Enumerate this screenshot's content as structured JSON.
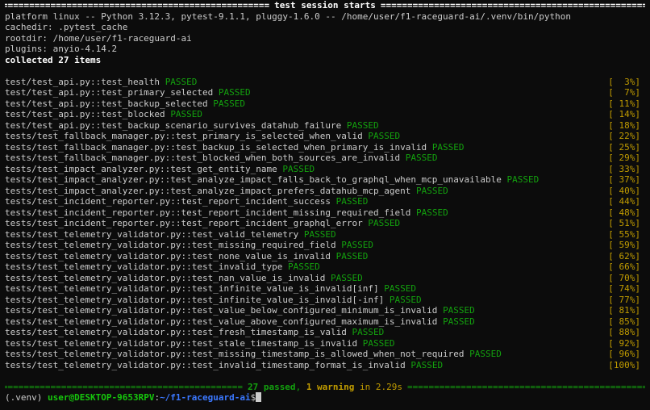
{
  "session": {
    "header_title": "test session starts",
    "platform_line": "platform linux -- Python 3.12.3, pytest-9.1.1, pluggy-1.6.0 -- /home/user/f1-raceguard-ai/.venv/bin/python",
    "cachedir_line": "cachedir: .pytest_cache",
    "rootdir_line": "rootdir: /home/user/f1-raceguard-ai",
    "plugins_line": "plugins: anyio-4.14.2",
    "collected_line": "collected 27 items"
  },
  "status_label": "PASSED",
  "tests": [
    {
      "name": "test/test_api.py::test_health",
      "pct": "[  3%]"
    },
    {
      "name": "test/test_api.py::test_primary_selected",
      "pct": "[  7%]"
    },
    {
      "name": "test/test_api.py::test_backup_selected",
      "pct": "[ 11%]"
    },
    {
      "name": "test/test_api.py::test_blocked",
      "pct": "[ 14%]"
    },
    {
      "name": "test/test_api.py::test_backup_scenario_survives_datahub_failure",
      "pct": "[ 18%]"
    },
    {
      "name": "tests/test_fallback_manager.py::test_primary_is_selected_when_valid",
      "pct": "[ 22%]"
    },
    {
      "name": "tests/test_fallback_manager.py::test_backup_is_selected_when_primary_is_invalid",
      "pct": "[ 25%]"
    },
    {
      "name": "tests/test_fallback_manager.py::test_blocked_when_both_sources_are_invalid",
      "pct": "[ 29%]"
    },
    {
      "name": "tests/test_impact_analyzer.py::test_get_entity_name",
      "pct": "[ 33%]"
    },
    {
      "name": "tests/test_impact_analyzer.py::test_analyze_impact_falls_back_to_graphql_when_mcp_unavailable",
      "pct": "[ 37%]"
    },
    {
      "name": "tests/test_impact_analyzer.py::test_analyze_impact_prefers_datahub_mcp_agent",
      "pct": "[ 40%]"
    },
    {
      "name": "tests/test_incident_reporter.py::test_report_incident_success",
      "pct": "[ 44%]"
    },
    {
      "name": "tests/test_incident_reporter.py::test_report_incident_missing_required_field",
      "pct": "[ 48%]"
    },
    {
      "name": "tests/test_incident_reporter.py::test_report_incident_graphql_error",
      "pct": "[ 51%]"
    },
    {
      "name": "tests/test_telemetry_validator.py::test_valid_telemetry",
      "pct": "[ 55%]"
    },
    {
      "name": "tests/test_telemetry_validator.py::test_missing_required_field",
      "pct": "[ 59%]"
    },
    {
      "name": "tests/test_telemetry_validator.py::test_none_value_is_invalid",
      "pct": "[ 62%]"
    },
    {
      "name": "tests/test_telemetry_validator.py::test_invalid_type",
      "pct": "[ 66%]"
    },
    {
      "name": "tests/test_telemetry_validator.py::test_nan_value_is_invalid",
      "pct": "[ 70%]"
    },
    {
      "name": "tests/test_telemetry_validator.py::test_infinite_value_is_invalid[inf]",
      "pct": "[ 74%]"
    },
    {
      "name": "tests/test_telemetry_validator.py::test_infinite_value_is_invalid[-inf]",
      "pct": "[ 77%]"
    },
    {
      "name": "tests/test_telemetry_validator.py::test_value_below_configured_minimum_is_invalid",
      "pct": "[ 81%]"
    },
    {
      "name": "tests/test_telemetry_validator.py::test_value_above_configured_maximum_is_invalid",
      "pct": "[ 85%]"
    },
    {
      "name": "tests/test_telemetry_validator.py::test_fresh_timestamp_is_valid",
      "pct": "[ 88%]"
    },
    {
      "name": "tests/test_telemetry_validator.py::test_stale_timestamp_is_invalid",
      "pct": "[ 92%]"
    },
    {
      "name": "tests/test_telemetry_validator.py::test_missing_timestamp_is_allowed_when_not_required",
      "pct": "[ 96%]"
    },
    {
      "name": "tests/test_telemetry_validator.py::test_invalid_timestamp_format_is_invalid",
      "pct": "[100%]"
    }
  ],
  "summary": {
    "passed": "27 passed",
    "separator": ", ",
    "warning": "1 warning",
    "duration": " in 2.29s"
  },
  "prompt": {
    "venv": "(.venv) ",
    "user_host": "user@DESKTOP-9653RPV",
    "colon": ":",
    "path": "~/f1-raceguard-ai",
    "symbol": "$"
  },
  "colors": {
    "background": "#0c0c0c",
    "text": "#cccccc",
    "passed": "#13a10e",
    "percent": "#c19c00",
    "prompt_user": "#16c60c",
    "prompt_path": "#3b78ff"
  }
}
